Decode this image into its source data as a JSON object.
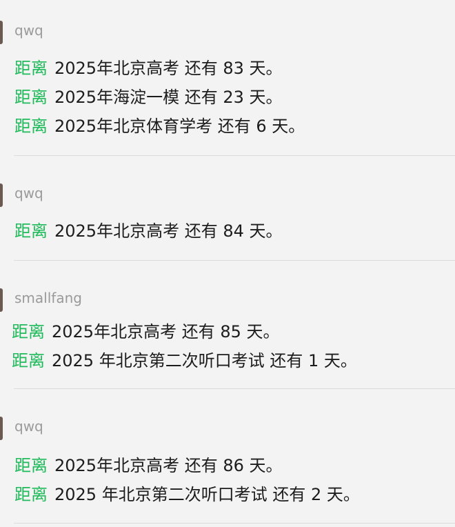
{
  "posts": [
    {
      "author": "qwq",
      "lines": [
        {
          "prefix": "距离",
          "text": "2025年北京高考 还有 83 天。"
        },
        {
          "prefix": "距离",
          "text": "2025年海淀一模 还有 23 天。"
        },
        {
          "prefix": "距离",
          "text": "2025年北京体育学考 还有 6 天。"
        }
      ]
    },
    {
      "author": "qwq",
      "lines": [
        {
          "prefix": "距离",
          "text": "2025年北京高考 还有 84 天。"
        }
      ]
    },
    {
      "author": "smallfang",
      "lines": [
        {
          "prefix": "距离",
          "text": "2025年北京高考 还有 85 天。"
        },
        {
          "prefix": "距离",
          "text": "2025 年北京第二次听口考试 还有 1 天。"
        }
      ]
    },
    {
      "author": "qwq",
      "lines": [
        {
          "prefix": "距离",
          "text": "2025年北京高考 还有 86 天。"
        },
        {
          "prefix": "距离",
          "text": "2025 年北京第二次听口考试 还有 2 天。"
        }
      ]
    }
  ],
  "colors": {
    "prefix": "#1fba5a",
    "author": "#9a9a9a",
    "text": "#1c1c1c",
    "background": "#f3f3f3"
  }
}
